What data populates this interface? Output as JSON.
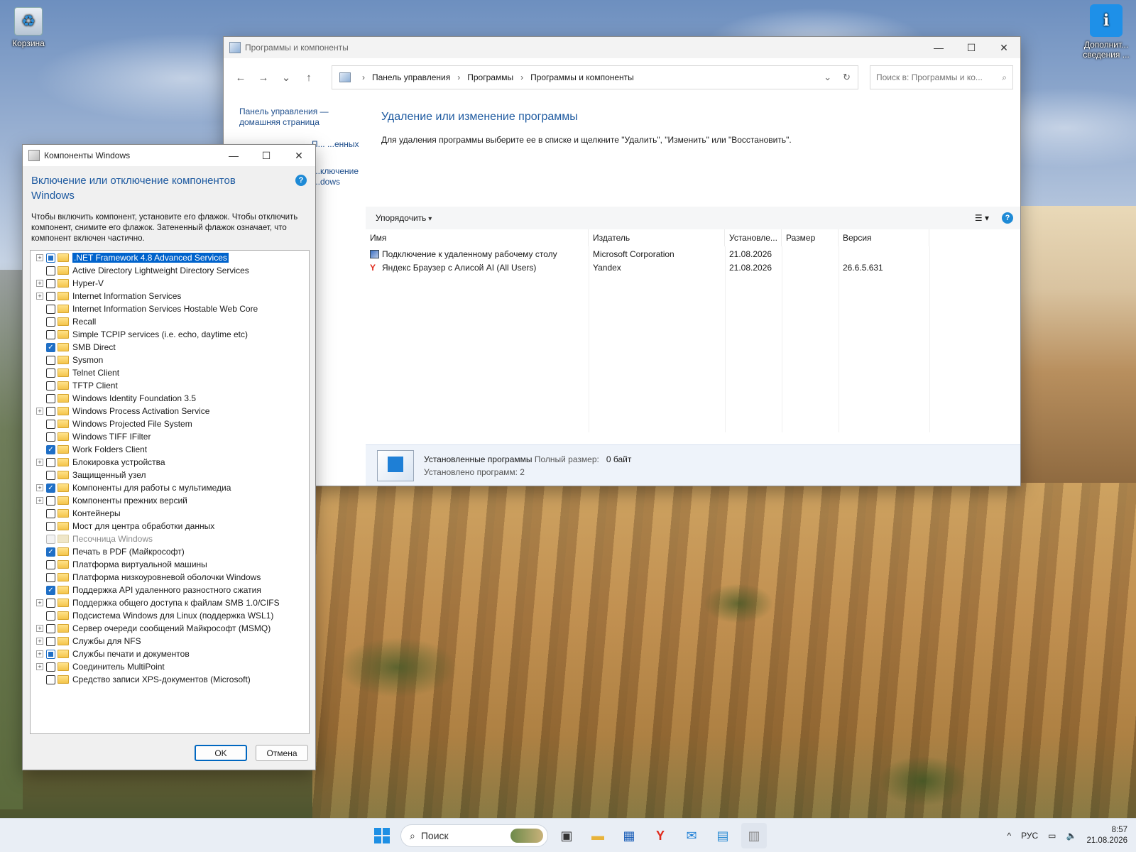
{
  "desktop": {
    "icons": [
      {
        "label": "Корзина",
        "icon": "recycle-bin-icon"
      },
      {
        "label": "Дополнит... сведения ...",
        "icon": "info-icon"
      }
    ]
  },
  "programs_window": {
    "title": "Программы и компоненты",
    "window_controls": {
      "minimize": "—",
      "maximize": "☐",
      "close": "✕"
    },
    "nav": {
      "back": "←",
      "forward": "→",
      "recent": "⌄",
      "up": "↑"
    },
    "breadcrumb": [
      "Панель управления",
      "Программы",
      "Программы и компоненты"
    ],
    "search_placeholder": "Поиск в: Программы и ко...",
    "left_links": {
      "home": "Панель управления — домашняя страница",
      "installed_updates_partial": "П... ...енных",
      "features_partial": "...ключение",
      "features_partial2": "...dows"
    },
    "heading": "Удаление или изменение программы",
    "hint": "Для удаления программы выберите ее в списке и щелкните \"Удалить\", \"Изменить\" или \"Восстановить\".",
    "organize": "Упорядочить",
    "columns": {
      "name": "Имя",
      "publisher": "Издатель",
      "installed": "Установле...",
      "size": "Размер",
      "version": "Версия"
    },
    "programs": [
      {
        "name": "Подключение к удаленному рабочему столу",
        "publisher": "Microsoft Corporation",
        "installed": "21.08.2026",
        "size": "",
        "version": "",
        "icon": "remote-desktop-icon"
      },
      {
        "name": "Яндекс Браузер с Алисой AI (All Users)",
        "publisher": "Yandex",
        "installed": "21.08.2026",
        "size": "",
        "version": "26.6.5.631",
        "icon": "yandex-icon"
      }
    ],
    "details": {
      "title": "Установленные программы",
      "total_label": "Полный размер:",
      "total_value": "0 байт",
      "count": "Установлено программ: 2"
    }
  },
  "features_dialog": {
    "title": "Компоненты Windows",
    "heading": "Включение или отключение компонентов Windows",
    "description": "Чтобы включить компонент, установите его флажок. Чтобы отключить компонент, снимите его флажок. Затененный флажок означает, что компонент включен частично.",
    "items": [
      {
        "label": ".NET Framework 4.8 Advanced Services",
        "expandable": true,
        "state": "partial",
        "selected": true
      },
      {
        "label": "Active Directory Lightweight Directory Services",
        "expandable": false,
        "state": "off"
      },
      {
        "label": "Hyper-V",
        "expandable": true,
        "state": "off"
      },
      {
        "label": "Internet Information Services",
        "expandable": true,
        "state": "off"
      },
      {
        "label": "Internet Information Services Hostable Web Core",
        "expandable": false,
        "state": "off"
      },
      {
        "label": "Recall",
        "expandable": false,
        "state": "off"
      },
      {
        "label": "Simple TCPIP services (i.e. echo, daytime etc)",
        "expandable": false,
        "state": "off"
      },
      {
        "label": "SMB Direct",
        "expandable": false,
        "state": "on"
      },
      {
        "label": "Sysmon",
        "expandable": false,
        "state": "off"
      },
      {
        "label": "Telnet Client",
        "expandable": false,
        "state": "off"
      },
      {
        "label": "TFTP Client",
        "expandable": false,
        "state": "off"
      },
      {
        "label": "Windows Identity Foundation 3.5",
        "expandable": false,
        "state": "off"
      },
      {
        "label": "Windows Process Activation Service",
        "expandable": true,
        "state": "off"
      },
      {
        "label": "Windows Projected File System",
        "expandable": false,
        "state": "off"
      },
      {
        "label": "Windows TIFF IFilter",
        "expandable": false,
        "state": "off"
      },
      {
        "label": "Work Folders Client",
        "expandable": false,
        "state": "on"
      },
      {
        "label": "Блокировка устройства",
        "expandable": true,
        "state": "off"
      },
      {
        "label": "Защищенный узел",
        "expandable": false,
        "state": "off"
      },
      {
        "label": "Компоненты для работы с мультимедиа",
        "expandable": true,
        "state": "on"
      },
      {
        "label": "Компоненты прежних версий",
        "expandable": true,
        "state": "off"
      },
      {
        "label": "Контейнеры",
        "expandable": false,
        "state": "off"
      },
      {
        "label": "Мост для центра обработки данных",
        "expandable": false,
        "state": "off"
      },
      {
        "label": "Песочница Windows",
        "expandable": false,
        "state": "disabled"
      },
      {
        "label": "Печать в PDF (Майкрософт)",
        "expandable": false,
        "state": "on"
      },
      {
        "label": "Платформа виртуальной машины",
        "expandable": false,
        "state": "off"
      },
      {
        "label": "Платформа низкоуровневой оболочки Windows",
        "expandable": false,
        "state": "off"
      },
      {
        "label": "Поддержка API удаленного разностного сжатия",
        "expandable": false,
        "state": "on"
      },
      {
        "label": "Поддержка общего доступа к файлам SMB 1.0/CIFS",
        "expandable": true,
        "state": "off"
      },
      {
        "label": "Подсистема Windows для Linux (поддержка WSL1)",
        "expandable": false,
        "state": "off"
      },
      {
        "label": "Сервер очереди сообщений Майкрософт (MSMQ)",
        "expandable": true,
        "state": "off"
      },
      {
        "label": "Службы для NFS",
        "expandable": true,
        "state": "off"
      },
      {
        "label": "Службы печати и документов",
        "expandable": true,
        "state": "partial"
      },
      {
        "label": "Соединитель MultiPoint",
        "expandable": true,
        "state": "off"
      },
      {
        "label": "Средство записи XPS-документов (Microsoft)",
        "expandable": false,
        "state": "off"
      }
    ],
    "ok": "OK",
    "cancel": "Отмена"
  },
  "taskbar": {
    "search_placeholder": "Поиск",
    "apps": [
      "start-icon",
      "task-view-icon",
      "file-explorer-icon",
      "store-icon",
      "yandex-browser-icon",
      "outlook-icon",
      "control-panel-icon",
      "features-icon"
    ],
    "tray": {
      "chevron": "^",
      "language": "РУС",
      "time": "8:57",
      "date": "21.08.2026"
    }
  },
  "colors": {
    "accent": "#0063cc",
    "link": "#1e4e8c",
    "heading": "#1e5aa0"
  }
}
